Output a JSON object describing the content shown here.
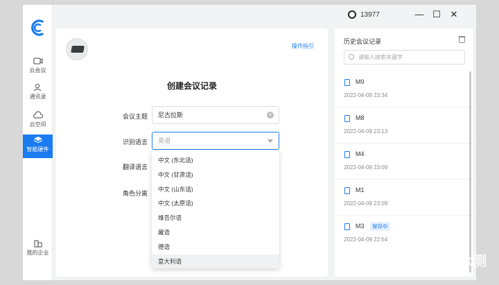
{
  "app": {
    "user": "13977",
    "window_controls": {
      "minimize": "—",
      "maximize": "☐",
      "close": "✕"
    }
  },
  "sidebar": {
    "items": [
      {
        "label": "云会议",
        "icon": "video-icon"
      },
      {
        "label": "通讯录",
        "icon": "contacts-icon"
      },
      {
        "label": "云空间",
        "icon": "cloud-icon"
      },
      {
        "label": "智能硬件",
        "icon": "layers-icon",
        "active": true
      },
      {
        "label": "我的企业",
        "icon": "building-icon"
      }
    ]
  },
  "main": {
    "guide_link": "操作指引",
    "title": "创建会议记录",
    "fields": {
      "topic_label": "会议主题",
      "topic_value": "尼古拉斯",
      "recog_lang_label": "识别语言",
      "recog_lang_placeholder": "英语",
      "trans_lang_label": "翻译语言",
      "role_sep_label": "角色分离"
    },
    "dropdown_options": [
      "中文 (东北话)",
      "中文 (甘肃话)",
      "中文 (山东话)",
      "中文 (太原话)",
      "维吾尔语",
      "藏语",
      "德语",
      "意大利语"
    ]
  },
  "history": {
    "title": "历史会议记录",
    "search_placeholder": "请输入搜索关键字",
    "records": [
      {
        "name": "M9",
        "date": "2022-04-09 23:34"
      },
      {
        "name": "M8",
        "date": "2022-04-09 23:13"
      },
      {
        "name": "M4",
        "date": "2022-04-09 23:09"
      },
      {
        "name": "M1",
        "date": "2022-04-09 23:09"
      },
      {
        "name": "M3",
        "badge": "保存中",
        "date": "2022-04-09 22:54"
      }
    ]
  },
  "watermark": "新浪众测",
  "colors": {
    "accent": "#1a7cf0",
    "background": "#f2f3f5"
  }
}
